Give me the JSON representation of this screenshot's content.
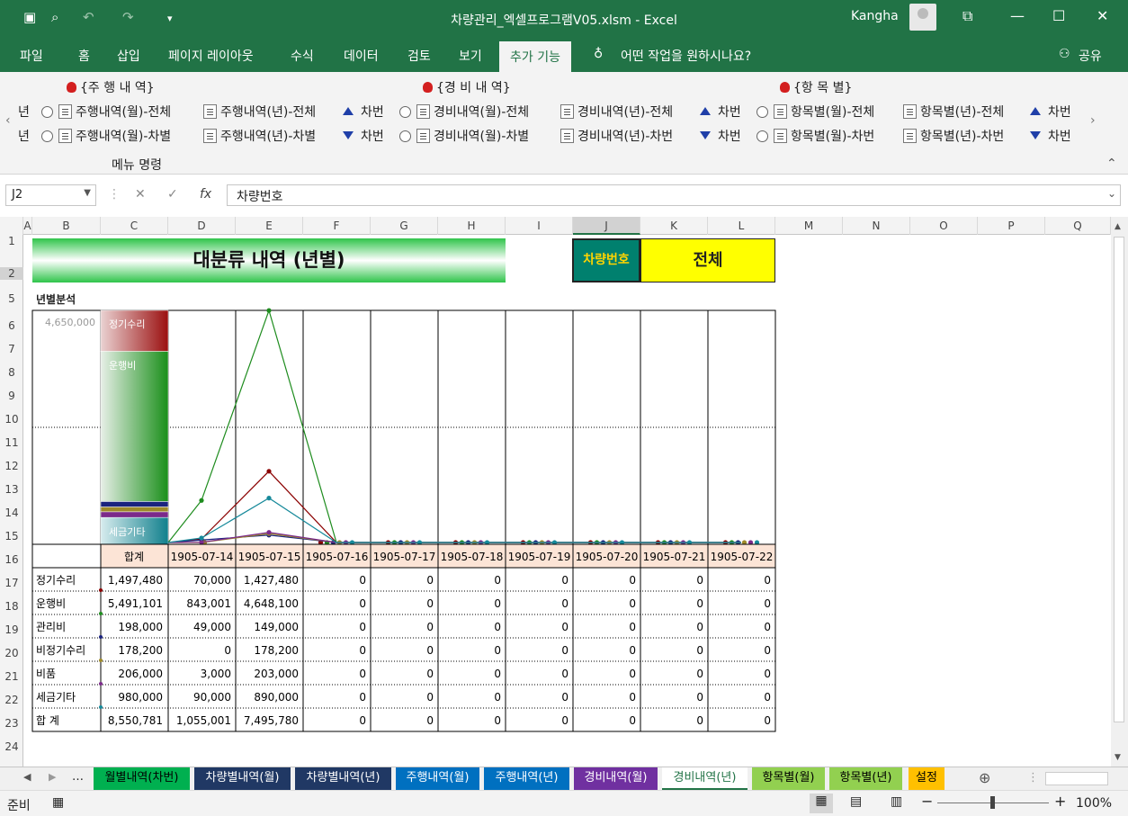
{
  "window": {
    "title": "차량관리_엑셀프로그램V05.xlsm  -  Excel",
    "user": "Kangha"
  },
  "tabs": [
    "파일",
    "홈",
    "삽입",
    "페이지 레이아웃",
    "수식",
    "데이터",
    "검토",
    "보기",
    "추가 기능"
  ],
  "tell_me": "어떤 작업을 원하시나요?",
  "share": "공유",
  "ribbon": {
    "group_label": "메뉴 명령",
    "clip_left": "년",
    "sections": [
      {
        "title": "{주 행 내 역}",
        "r1": "주행내역(월)-전체",
        "r2": "주행내역(월)-차별",
        "b1": "주행내역(년)-전체",
        "b2": "주행내역(년)-차별",
        "s1": "차번",
        "s2": "차번"
      },
      {
        "title": "{경 비 내 역}",
        "r1": "경비내역(월)-전체",
        "r2": "경비내역(월)-차별",
        "b1": "경비내역(년)-전체",
        "b2": "경비내역(년)-차번",
        "s1": "차번",
        "s2": "차번"
      },
      {
        "title": "{항 목 별}",
        "r1": "항목별(월)-전체",
        "r2": "항목별(월)-차번",
        "b1": "항목별(년)-전체",
        "b2": "항목별(년)-차번",
        "s1": "차번",
        "s2": "차번"
      }
    ]
  },
  "namebox": "J2",
  "formula": "차량번호",
  "columns": [
    "A",
    "B",
    "C",
    "D",
    "E",
    "F",
    "G",
    "H",
    "I",
    "J",
    "K",
    "L",
    "M",
    "N",
    "O",
    "P",
    "Q"
  ],
  "rows": [
    "1",
    "2",
    "5",
    "6",
    "7",
    "8",
    "9",
    "10",
    "11",
    "12",
    "13",
    "14",
    "15",
    "16",
    "17",
    "18",
    "19",
    "20",
    "21",
    "22",
    "23",
    "24"
  ],
  "sheet": {
    "title": "대분류 내역 (년별)",
    "vehicle_label": "차량번호",
    "vehicle_value": "전체",
    "section_label": "년별분석",
    "bar_axis_label": "4,650,000",
    "bar_labels": {
      "top": "정기수리",
      "mid": "운행비",
      "bottom": "세금기타"
    },
    "table_header_total": "합계",
    "dates": [
      "1905-07-14",
      "1905-07-15",
      "1905-07-16",
      "1905-07-17",
      "1905-07-18",
      "1905-07-19",
      "1905-07-20",
      "1905-07-21",
      "1905-07-22"
    ],
    "table": [
      {
        "label": "정기수리",
        "total": "1,497,480",
        "vals": [
          "70,000",
          "1,427,480",
          "0",
          "0",
          "0",
          "0",
          "0",
          "0",
          "0"
        ]
      },
      {
        "label": "운행비",
        "total": "5,491,101",
        "vals": [
          "843,001",
          "4,648,100",
          "0",
          "0",
          "0",
          "0",
          "0",
          "0",
          "0"
        ]
      },
      {
        "label": "관리비",
        "total": "198,000",
        "vals": [
          "49,000",
          "149,000",
          "0",
          "0",
          "0",
          "0",
          "0",
          "0",
          "0"
        ]
      },
      {
        "label": "비정기수리",
        "total": "178,200",
        "vals": [
          "0",
          "178,200",
          "0",
          "0",
          "0",
          "0",
          "0",
          "0",
          "0"
        ]
      },
      {
        "label": "비품",
        "total": "206,000",
        "vals": [
          "3,000",
          "203,000",
          "0",
          "0",
          "0",
          "0",
          "0",
          "0",
          "0"
        ]
      },
      {
        "label": "세금기타",
        "total": "980,000",
        "vals": [
          "90,000",
          "890,000",
          "0",
          "0",
          "0",
          "0",
          "0",
          "0",
          "0"
        ]
      },
      {
        "label": "합 계",
        "total": "8,550,781",
        "vals": [
          "1,055,001",
          "7,495,780",
          "0",
          "0",
          "0",
          "0",
          "0",
          "0",
          "0"
        ]
      }
    ]
  },
  "chart_data": {
    "type": "line",
    "categories": [
      "1905-07-14",
      "1905-07-15",
      "1905-07-16",
      "1905-07-17",
      "1905-07-18",
      "1905-07-19",
      "1905-07-20",
      "1905-07-21",
      "1905-07-22"
    ],
    "ylim": [
      0,
      4650000
    ],
    "series": [
      {
        "name": "정기수리",
        "color": "#8b0000",
        "values": [
          70000,
          1427480,
          0,
          0,
          0,
          0,
          0,
          0,
          0
        ]
      },
      {
        "name": "운행비",
        "color": "#1e8c1e",
        "values": [
          843001,
          4648100,
          0,
          0,
          0,
          0,
          0,
          0,
          0
        ]
      },
      {
        "name": "관리비",
        "color": "#1a237e",
        "values": [
          49000,
          149000,
          0,
          0,
          0,
          0,
          0,
          0,
          0
        ]
      },
      {
        "name": "비정기수리",
        "color": "#9e8a2a",
        "values": [
          0,
          178200,
          0,
          0,
          0,
          0,
          0,
          0,
          0
        ]
      },
      {
        "name": "비품",
        "color": "#7b2a8a",
        "values": [
          3000,
          203000,
          0,
          0,
          0,
          0,
          0,
          0,
          0
        ]
      },
      {
        "name": "세금기타",
        "color": "#16899a",
        "values": [
          90000,
          890000,
          0,
          0,
          0,
          0,
          0,
          0,
          0
        ]
      }
    ]
  },
  "sheet_tabs": [
    {
      "label": "월별내역(차번)",
      "bg": "#00b050",
      "fg": "#000"
    },
    {
      "label": "차량별내역(월)",
      "bg": "#203864",
      "fg": "#fff"
    },
    {
      "label": "차량별내역(년)",
      "bg": "#203864",
      "fg": "#fff"
    },
    {
      "label": "주행내역(월)",
      "bg": "#0070c0",
      "fg": "#fff"
    },
    {
      "label": "주행내역(년)",
      "bg": "#0070c0",
      "fg": "#fff"
    },
    {
      "label": "경비내역(월)",
      "bg": "#7030a0",
      "fg": "#fff"
    },
    {
      "label": "경비내역(년)",
      "bg": "#ffffff",
      "fg": "#217346"
    },
    {
      "label": "항목별(월)",
      "bg": "#92d050",
      "fg": "#000"
    },
    {
      "label": "항목별(년)",
      "bg": "#92d050",
      "fg": "#000"
    },
    {
      "label": "설정",
      "bg": "#ffc000",
      "fg": "#000"
    }
  ],
  "status": {
    "ready": "준비",
    "zoom": "100%"
  }
}
